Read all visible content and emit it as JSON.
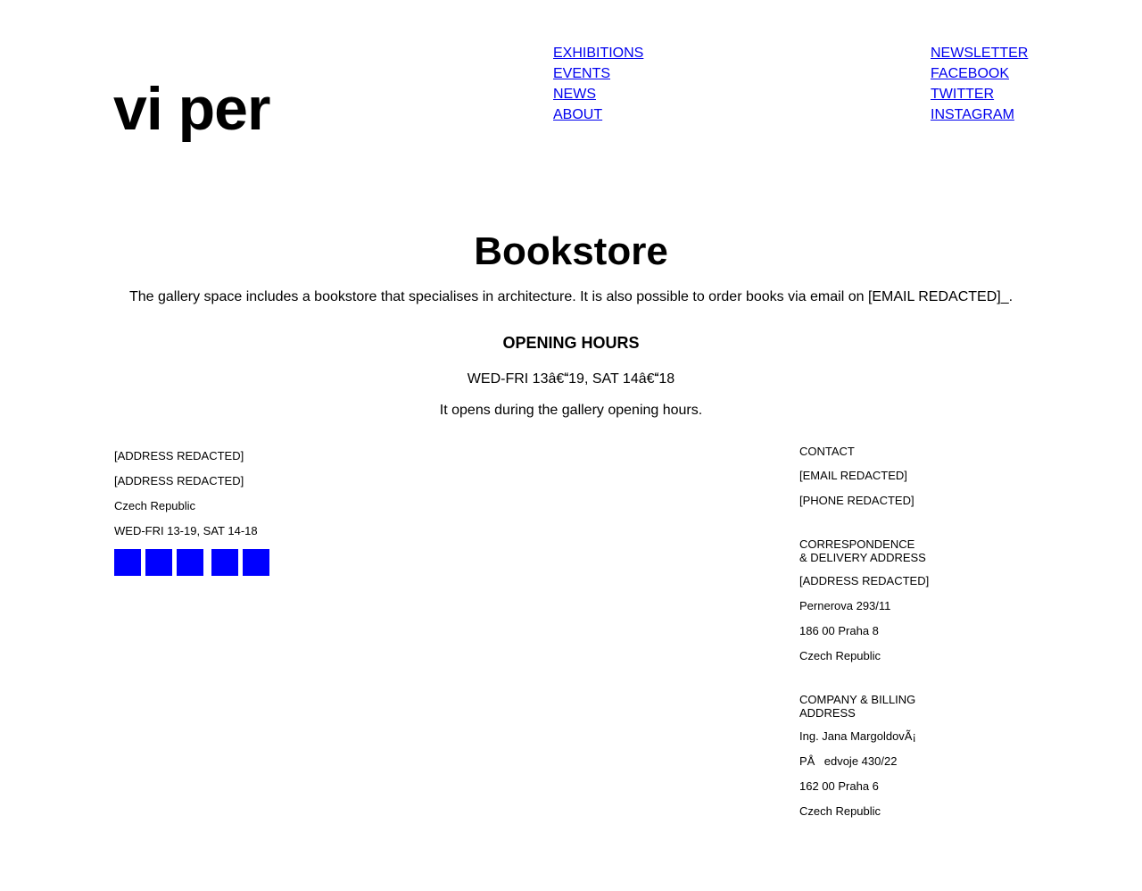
{
  "logo": "vi per",
  "nav_main": [
    {
      "label": "EXHIBITIONS"
    },
    {
      "label": "EVENTS"
    },
    {
      "label": "NEWS"
    },
    {
      "label": "ABOUT"
    }
  ],
  "nav_social": [
    {
      "label": "NEWSLETTER"
    },
    {
      "label": "FACEBOOK"
    },
    {
      "label": "TWITTER"
    },
    {
      "label": "INSTAGRAM"
    }
  ],
  "main": {
    "title": "Bookstore",
    "intro": "The gallery space includes a bookstore that specialises in architecture. It is also possible to order books via email on [EMAIL REDACTED]_.",
    "hours_heading": "OPENING HOURS",
    "hours_value": "WED-FRI 13â€19, SAT 14â€18",
    "hours_note": "It opens during the gallery opening hours."
  },
  "footer_left": {
    "lines": [
      "[ADDRESS REDACTED]",
      "[ADDRESS REDACTED]",
      "Czech Republic",
      "WED-FRI 13-19, SAT 14-18"
    ],
    "social_icons": [
      "social-icon-1",
      "social-icon-2",
      "social-icon-3",
      "social-icon-4",
      "social-icon-5"
    ],
    "icon_color": "#0000ff"
  },
  "footer_right": {
    "contact": {
      "label": "CONTACT",
      "lines": [
        "[EMAIL REDACTED]",
        "[PHONE REDACTED]"
      ]
    },
    "correspondence": {
      "label_line1": "CORRESPONDENCE",
      "label_line2": "& DELIVERY ADDRESS",
      "lines": [
        "[ADDRESS REDACTED]",
        "Pernerova 293/11",
        "186 00 Praha 8",
        "Czech Republic"
      ]
    },
    "company": {
      "label_line1": "COMPANY & BILLING",
      "label_line2": "ADDRESS",
      "lines": [
        "Ing. Jana MargoldovÃ¡",
        "PÅedvoje 430/22",
        "162 00 Praha 6",
        "Czech Republic"
      ]
    }
  },
  "colors": {
    "link": "#0000ee",
    "text": "#000000",
    "background": "#ffffff"
  }
}
